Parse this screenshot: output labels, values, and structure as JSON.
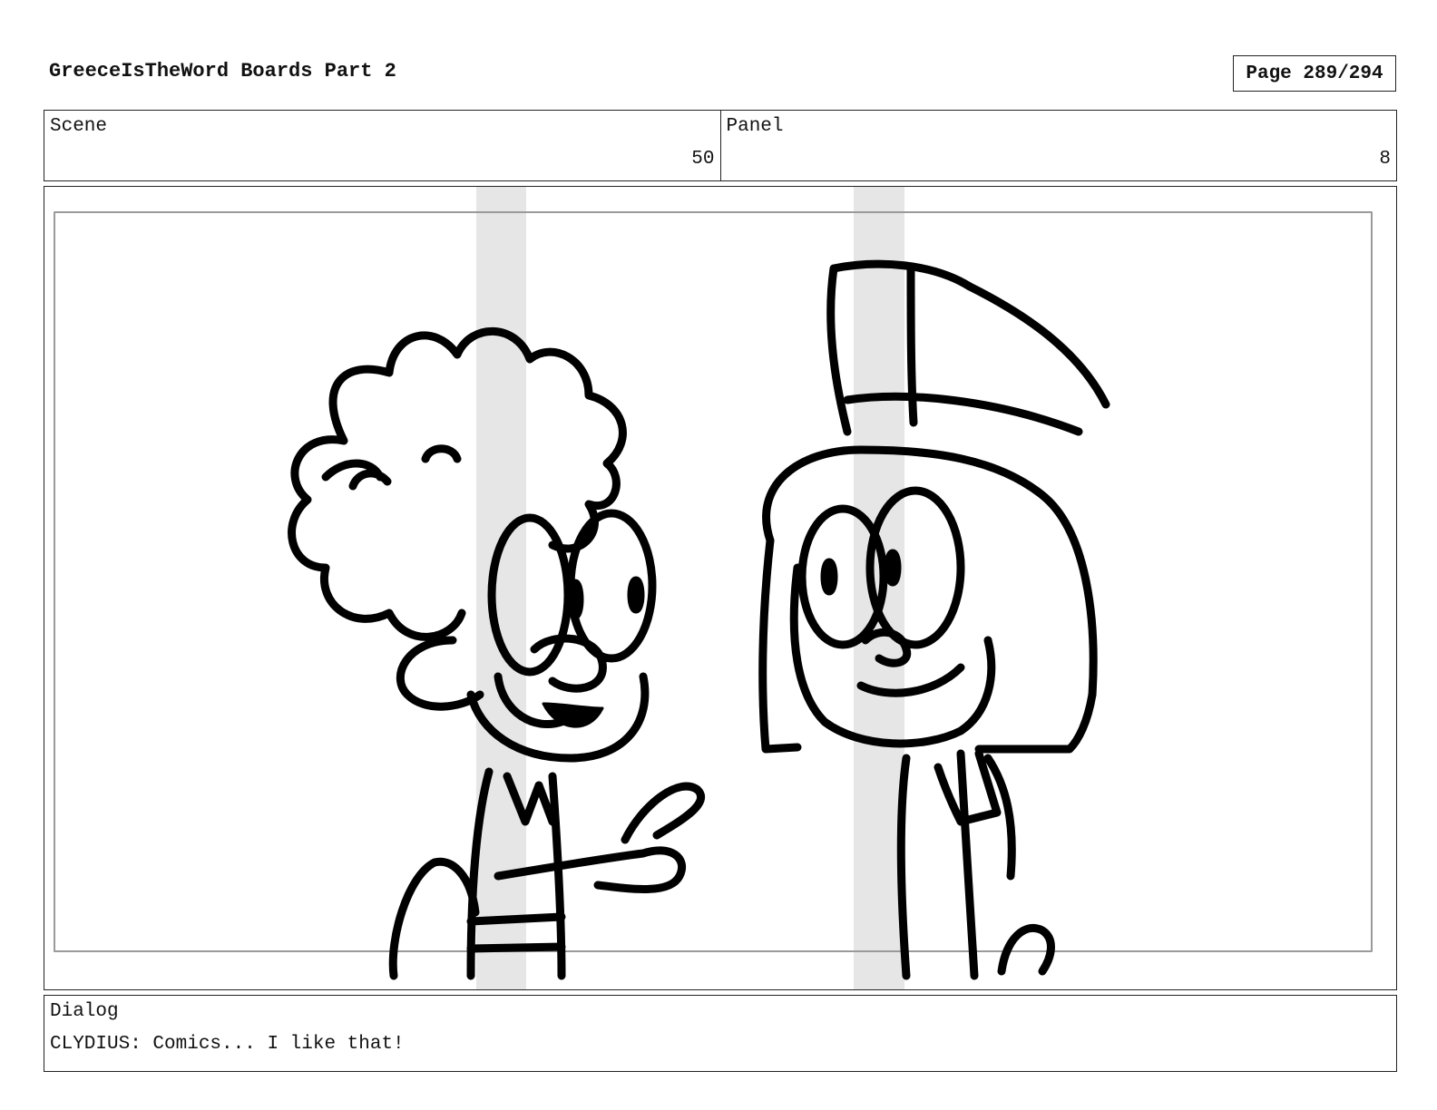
{
  "header": {
    "title": "GreeceIsTheWord Boards Part 2",
    "page": "Page 289/294"
  },
  "info": {
    "scene_label": "Scene",
    "scene_value": "50",
    "panel_label": "Panel",
    "panel_value": "8"
  },
  "dialog": {
    "label": "Dialog",
    "text": "CLYDIUS: Comics... I like that!"
  }
}
